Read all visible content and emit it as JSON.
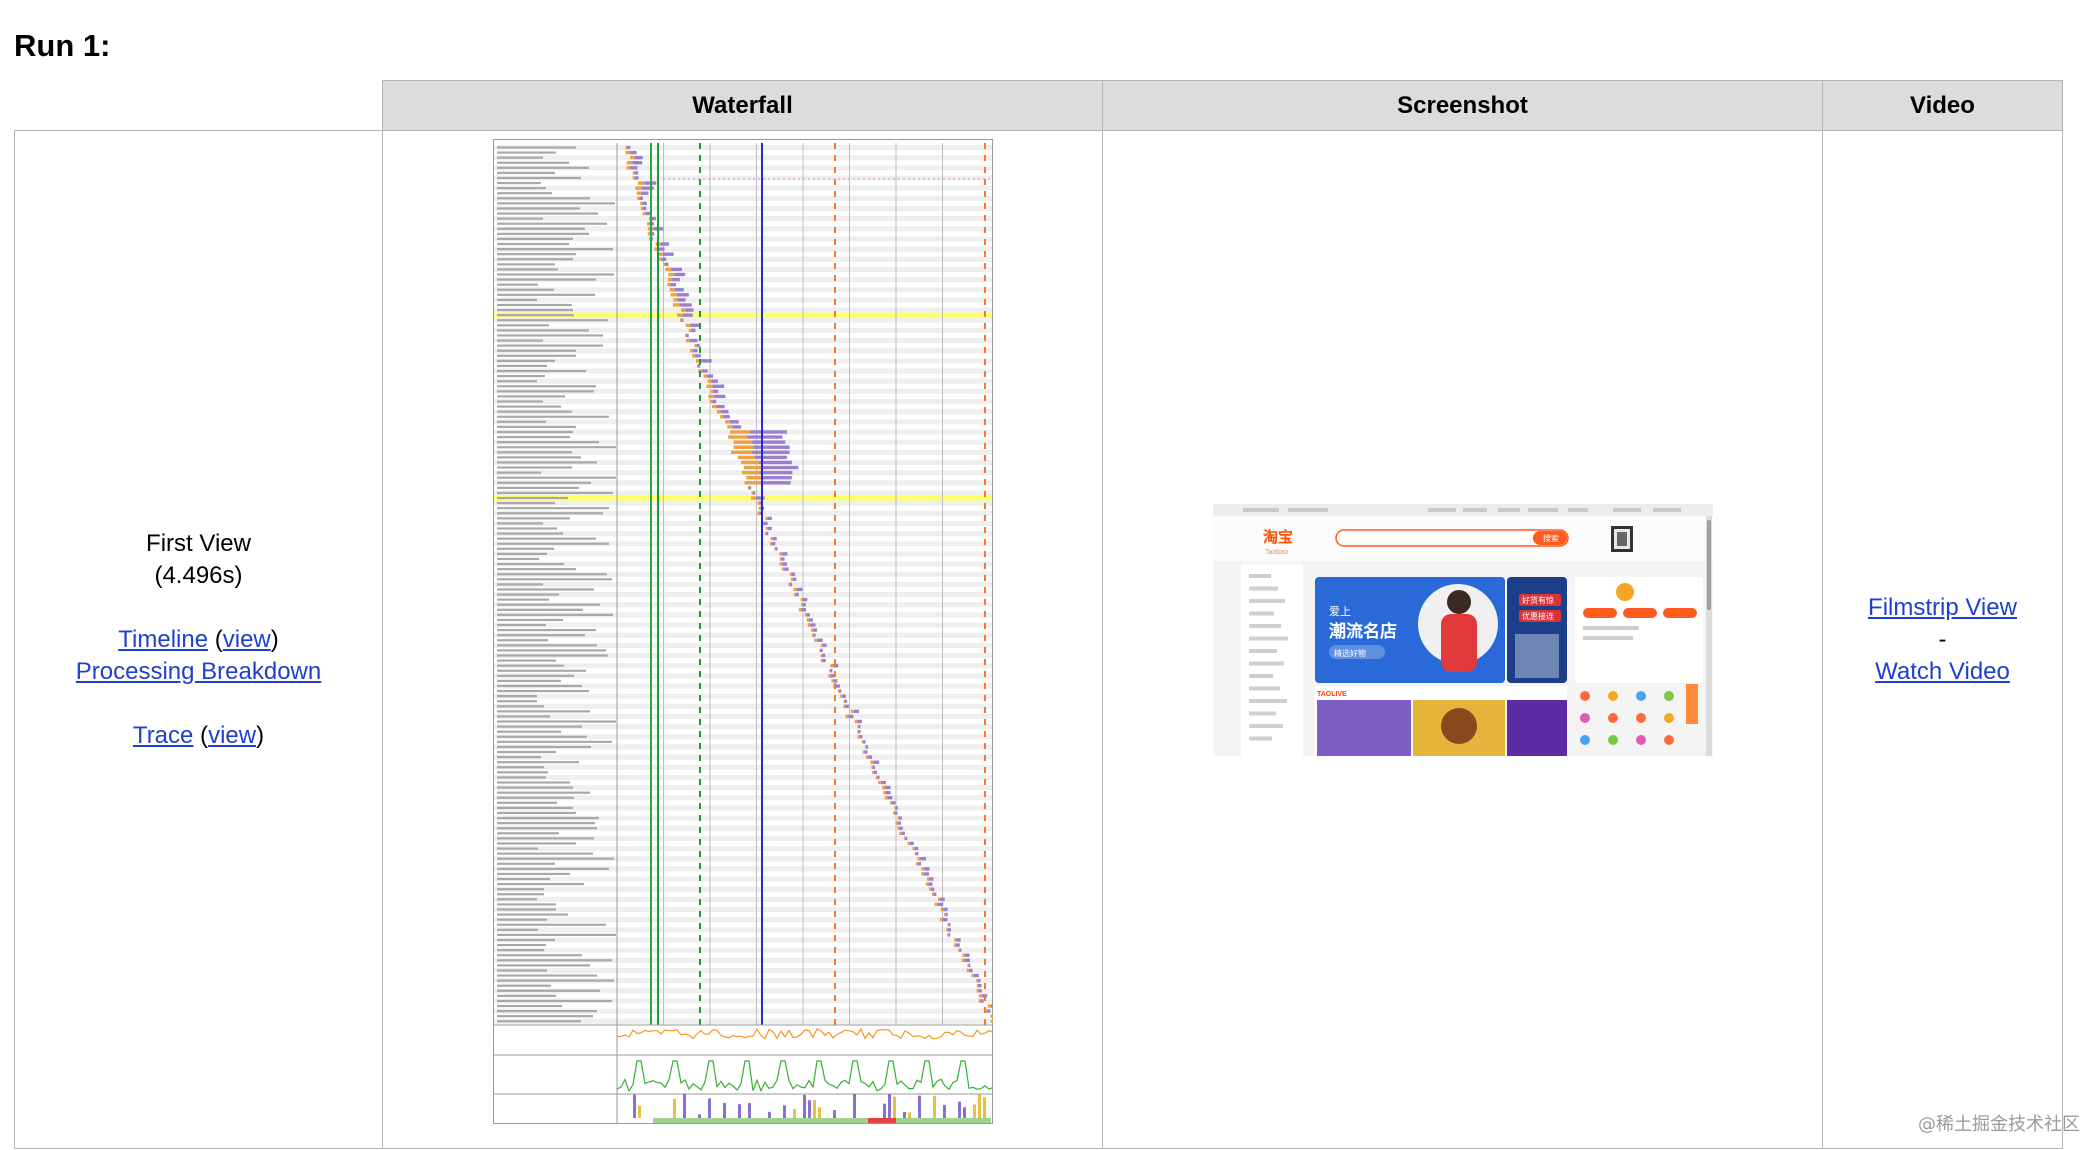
{
  "run_heading": "Run 1:",
  "columns": {
    "waterfall": "Waterfall",
    "screenshot": "Screenshot",
    "video": "Video"
  },
  "first_view": {
    "label": "First View",
    "time": "(4.496s)",
    "timeline": "Timeline",
    "timeline_view": "view",
    "processing": "Processing Breakdown",
    "trace": "Trace",
    "trace_view": "view"
  },
  "video": {
    "filmstrip": "Filmstrip View",
    "separator": "-",
    "watch": "Watch Video"
  },
  "screenshot_page": {
    "logo": "淘宝",
    "logo_sub": "Taobao",
    "search_button": "搜索",
    "banner_line1": "爱上",
    "banner_line2": "潮流名店",
    "banner_cta": "精选好物",
    "promo_line1": "好货有惊",
    "promo_line2": "优惠接连",
    "section_title": "TAOLIVE"
  },
  "watermark": "@稀土掘金技术社区",
  "colors": {
    "header_bg": "#dcdcdc",
    "link": "#1f3fd1",
    "highlight_row": "#ffff66",
    "start_render": "#28a745",
    "dom_content_loaded": "#1f9c2f",
    "on_load": "#2828d8",
    "document_complete": "#f07b2a",
    "cpu_line": "#f5961e",
    "bandwidth_line": "#33b133"
  }
}
